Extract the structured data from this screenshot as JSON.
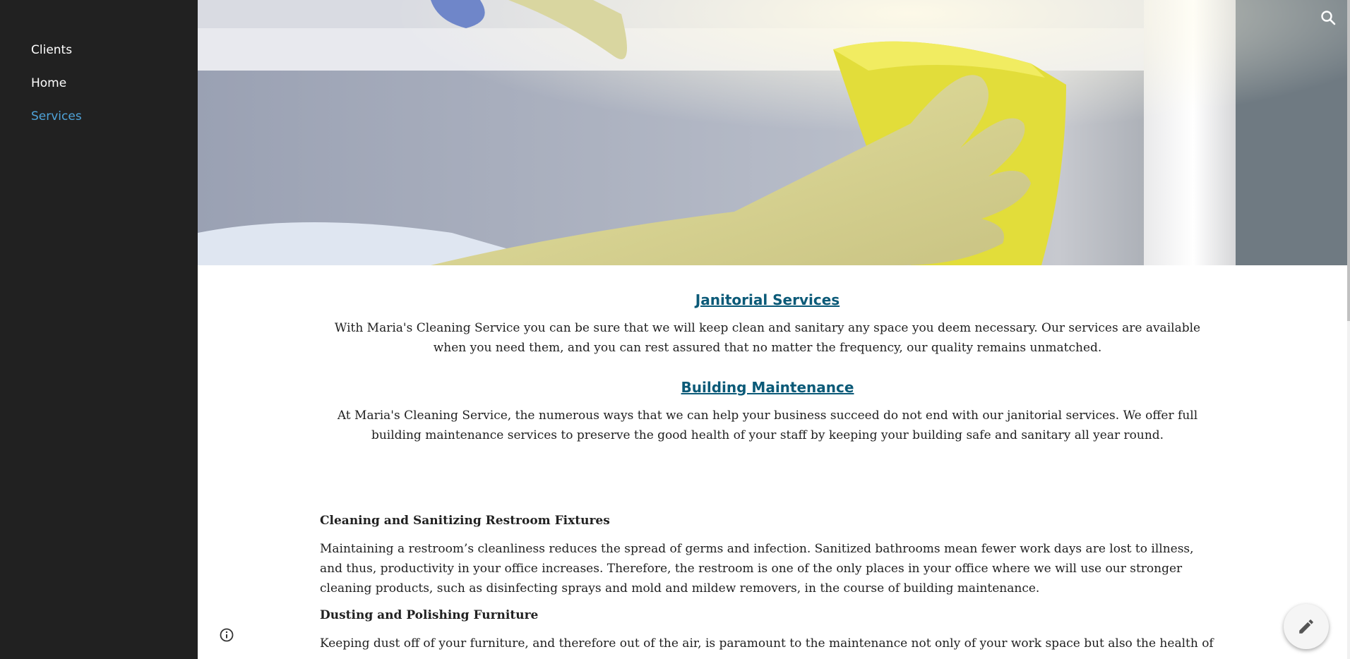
{
  "sidebar": {
    "items": [
      {
        "label": "Clients",
        "active": false
      },
      {
        "label": "Home",
        "active": false
      },
      {
        "label": "Services",
        "active": true
      }
    ]
  },
  "colors": {
    "sidebar_bg": "#212121",
    "active_nav": "#4fa3d9",
    "heading_link": "#0b5a78"
  },
  "hero": {
    "icon": "search-icon"
  },
  "content": {
    "heading1": "Janitorial Services",
    "para1": "With Maria's Cleaning Service you can be sure that we will keep clean and sanitary any space you deem necessary. Our services are available when you need them, and you can rest assured that no matter the frequency, our quality remains unmatched.",
    "heading2": "Building Maintenance",
    "para2": "At Maria's Cleaning Service, the numerous ways that we can help your business succeed do not end with our janitorial services. We offer full building maintenance services to preserve the good health of your staff by keeping your building safe and sanitary all year round.",
    "section1_title": "Cleaning and Sanitizing Restroom Fixtures",
    "section1_body": "Maintaining a restroom’s cleanliness reduces the spread of germs and infection. Sanitized bathrooms mean fewer work days are lost to illness, and thus, productivity in your office increases. Therefore, the restroom is one of the only places in your office where we will use our stronger cleaning products, such as disinfecting sprays and mold and mildew removers, in the course of building maintenance.",
    "section2_title": "Dusting and Polishing Furniture",
    "section2_body": "Keeping dust off of your furniture, and therefore out of the air, is paramount to the maintenance not only of your work space but also the health of your"
  },
  "controls": {
    "info_icon": "info-icon",
    "edit_icon": "pencil-icon"
  }
}
